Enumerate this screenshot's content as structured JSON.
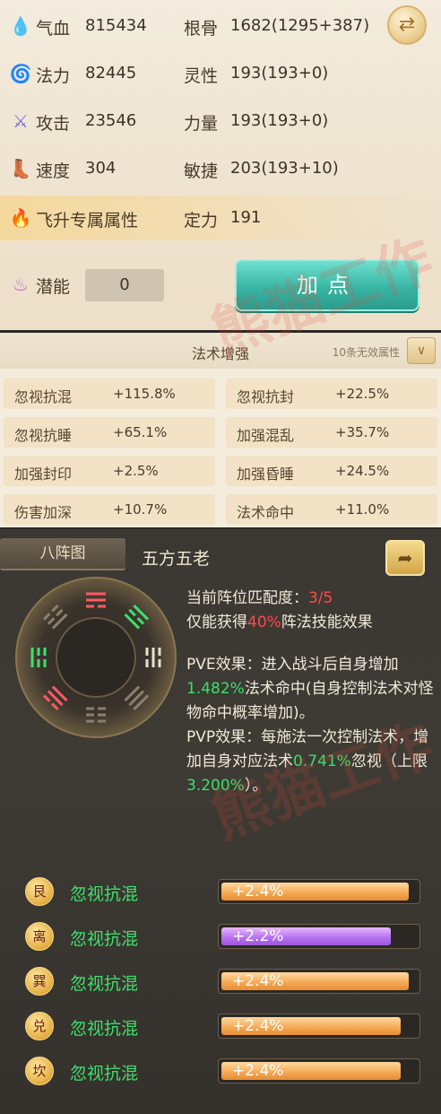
{
  "attributes": {
    "rows": [
      {
        "icon": "blood-drop-icon",
        "label": "气血",
        "value": "815434",
        "label2": "根骨",
        "value2": "1682(1295+387)"
      },
      {
        "icon": "mana-swirl-icon",
        "label": "法力",
        "value": "82445",
        "label2": "灵性",
        "value2": "193(193+0)"
      },
      {
        "icon": "sword-icon",
        "label": "攻击",
        "value": "23546",
        "label2": "力量",
        "value2": "193(193+0)"
      },
      {
        "icon": "boot-icon",
        "label": "速度",
        "value": "304",
        "label2": "敏捷",
        "value2": "203(193+10)"
      },
      {
        "icon": "flame-lotus-icon",
        "label": "飞升专属属性",
        "value": "",
        "label2": "定力",
        "value2": "191"
      }
    ],
    "potential_label": "潜能",
    "potential_value": "0",
    "add_point_label": "加点"
  },
  "spell_enhance": {
    "title": "法术增强",
    "note": "10条无效属性",
    "items": [
      {
        "name": "忽视抗混",
        "value": "+115.8%"
      },
      {
        "name": "忽视抗封",
        "value": "+22.5%"
      },
      {
        "name": "忽视抗睡",
        "value": "+65.1%"
      },
      {
        "name": "加强混乱",
        "value": "+35.7%"
      },
      {
        "name": "加强封印",
        "value": "+2.5%"
      },
      {
        "name": "加强昏睡",
        "value": "+24.5%"
      },
      {
        "name": "伤害加深",
        "value": "+10.7%"
      },
      {
        "name": "法术命中",
        "value": "+11.0%"
      }
    ]
  },
  "formation": {
    "tab_label": "八阵图",
    "name": "五方五老",
    "match_label": "当前阵位匹配度：",
    "match_value": "3/5",
    "effect_prefix": "仅能获得",
    "effect_pct": "40%",
    "effect_suffix": "阵法技能效果",
    "pve_a": "PVE效果：进入战斗后自身增加",
    "pve_pct": "1.482%",
    "pve_b": "法术命中(自身控制法术对怪物命中概率增加)。",
    "pvp_a": "PVP效果：每施法一次控制法术，增加自身对应法术",
    "pvp_pct": "0.741%",
    "pvp_b": "忽视（上限",
    "pvp_cap": "3.200%",
    "pvp_c": "）。",
    "bonuses": [
      {
        "badge": "艮",
        "text": "忽视抗混",
        "value": "+2.4%",
        "fill_pct": 96,
        "color": "orange"
      },
      {
        "badge": "离",
        "text": "忽视抗混",
        "value": "+2.2%",
        "fill_pct": 87,
        "color": "purple"
      },
      {
        "badge": "巽",
        "text": "忽视抗混",
        "value": "+2.4%",
        "fill_pct": 96,
        "color": "orange"
      },
      {
        "badge": "兑",
        "text": "忽视抗混",
        "value": "+2.4%",
        "fill_pct": 92,
        "color": "orange"
      },
      {
        "badge": "坎",
        "text": "忽视抗混",
        "value": "+2.4%",
        "fill_pct": 92,
        "color": "orange"
      }
    ]
  },
  "watermark": "熊猫工作"
}
